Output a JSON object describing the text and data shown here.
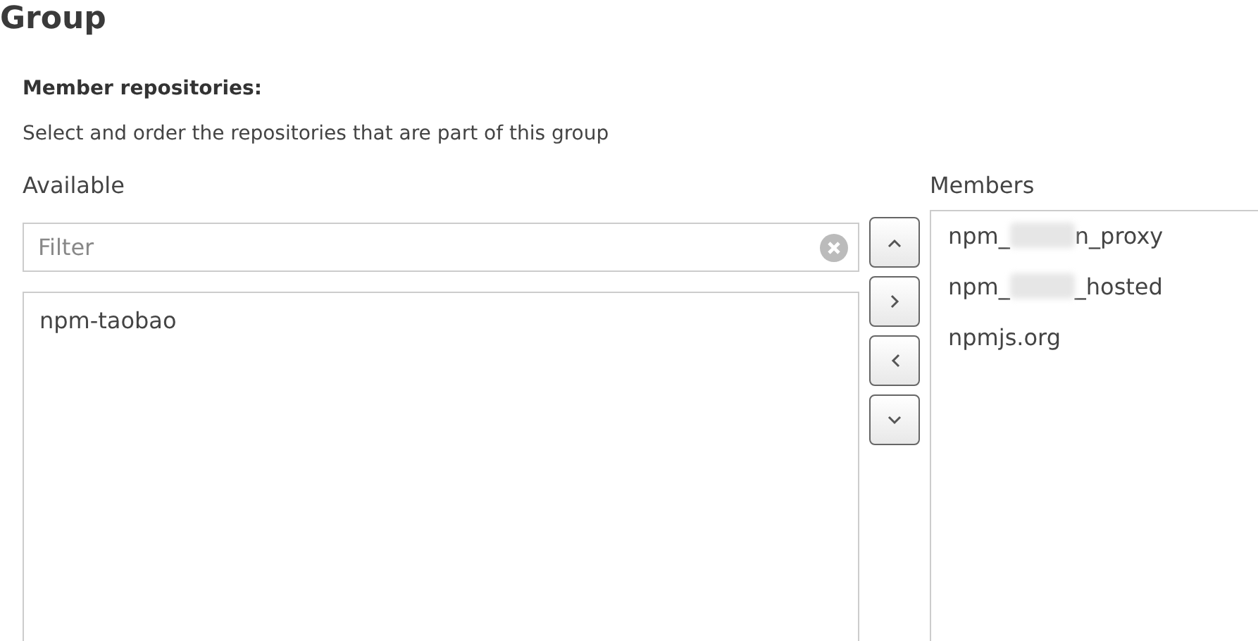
{
  "title": "Group",
  "section": {
    "heading": "Member repositories:",
    "description": "Select and order the repositories that are part of this group"
  },
  "available": {
    "label": "Available",
    "filter": {
      "placeholder": "Filter"
    },
    "items": [
      {
        "label": "npm-taobao",
        "selected": false
      }
    ]
  },
  "members": {
    "label": "Members",
    "items": [
      {
        "kind": "redacted",
        "prefix": "npm_",
        "suffix": "n_proxy",
        "selected": false
      },
      {
        "kind": "redacted",
        "prefix": "npm_",
        "suffix": "_hosted",
        "selected": false
      },
      {
        "kind": "plain",
        "label": "npmjs.org",
        "selected": false
      }
    ]
  }
}
